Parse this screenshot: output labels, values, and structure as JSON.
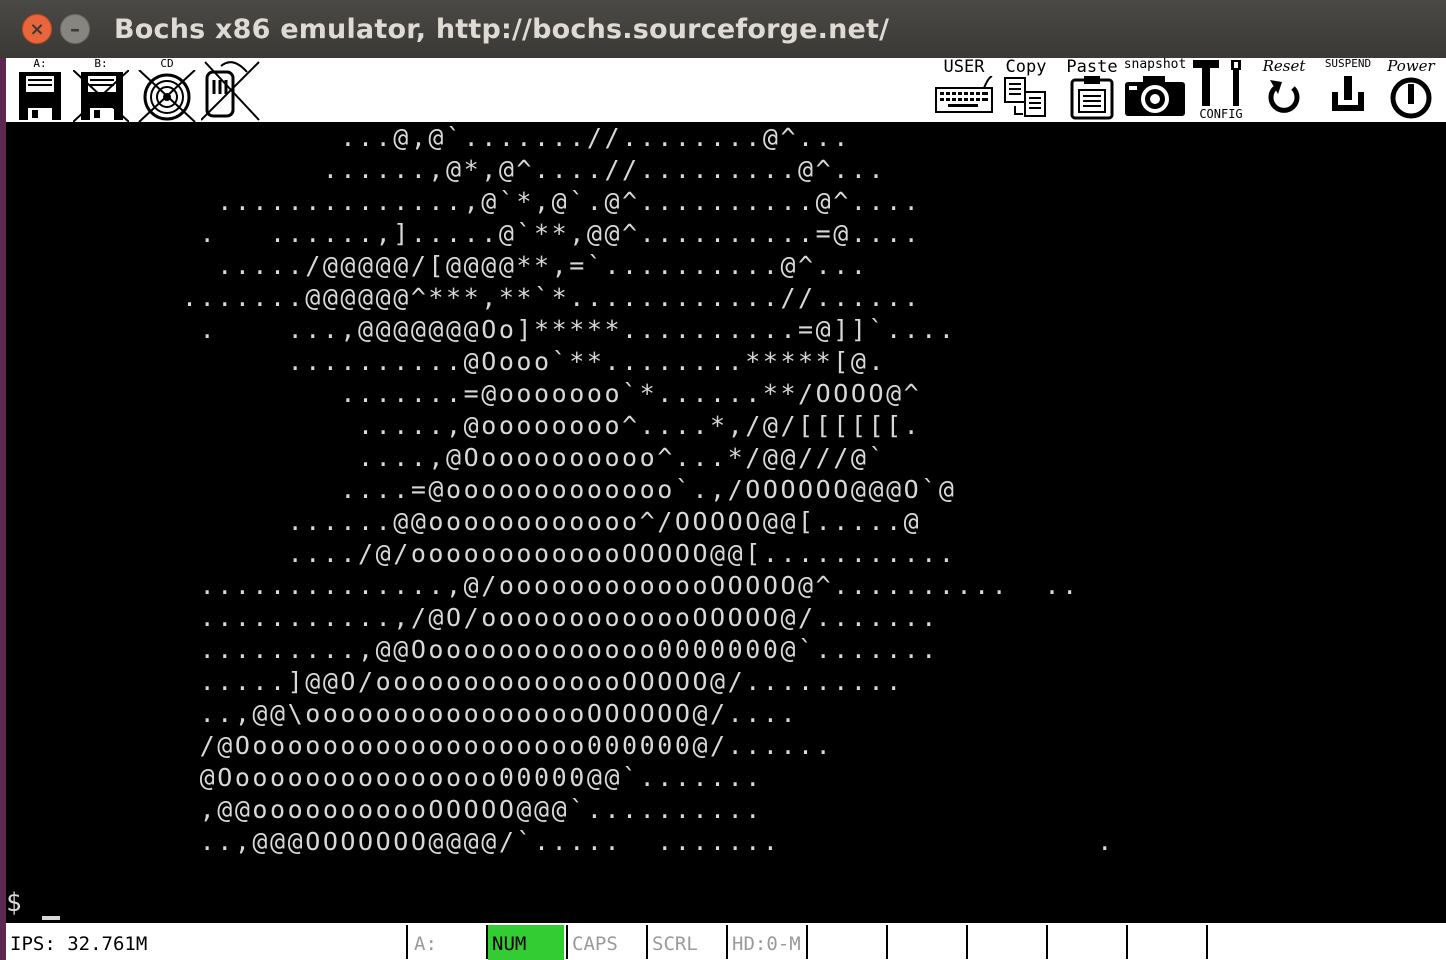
{
  "window": {
    "title": "Bochs x86 emulator, http://bochs.sourceforge.net/",
    "close_glyph": "×",
    "minimize_glyph": "–"
  },
  "toolbar": {
    "floppy_a_label": "A:",
    "floppy_b_label": "B:",
    "cdrom_label": "CD",
    "user_label": "USER",
    "copy_label": "Copy",
    "paste_label": "Paste",
    "snapshot_label": "snapshot",
    "config_label": "CONFIG",
    "reset_label": "Reset",
    "suspend_label": "SUSPEND",
    "power_label": "Power"
  },
  "screen": {
    "lines": [
      "                   ...@,@`.......//........@^...",
      "                  ......,@*,@^....//.........@^...",
      "            ..............,@`*,@`.@^..........@^....",
      "           .   ......,].....@`**,@@^..........=@....",
      "            ...../@@@@@/[@@@@**,=`..........@^...",
      "          .......@@@@@@^***,**`*............//......",
      "           .    ...,@@@@@@@Oo]*****..........=@]]`....",
      "                ..........@Oooo`**........*****[@.",
      "                   .......=@ooooooo`*......**/OOOO@^",
      "                    .....,@oooooooo^....*,/@/[[[[[[.",
      "                    ....,@Ooooooooooo^...*/@@///@`",
      "                   ....=@ooooooooooooo`.,/OOOOOO@@@O`@",
      "                ......@@oooooooooooo^/OOOOO@@[.....@",
      "                ..../@/ooooooooooooOOOOO@@[...........",
      "           ..............,@/ooooooooooooOOOOO@^..........  ..",
      "           ...........,/@O/ooooooooooooOOOOO@/.......",
      "           .........,@@Oooooooooooooo0000000@`.......",
      "           .....]@@O/ooooooooooooooOOOOO@/.........",
      "           ..,@@\\ooooooooooooooooOOOOOO@/....",
      "           /@Oooooooooooooooooooo000000@/......",
      "           @Oooooooooooooooo00000@@`.......",
      "           ,@@ooooooooooOOOOO@@@`..........",
      "           ..,@@@OOOOOOO@@@@/`.....  .......                  ."
    ],
    "prompt": "$"
  },
  "statusbar": {
    "ips": "IPS: 32.761M",
    "drive_a": "A:",
    "num": "NUM",
    "caps": "CAPS",
    "scrl": "SCRL",
    "hd": "HD:0-M"
  }
}
